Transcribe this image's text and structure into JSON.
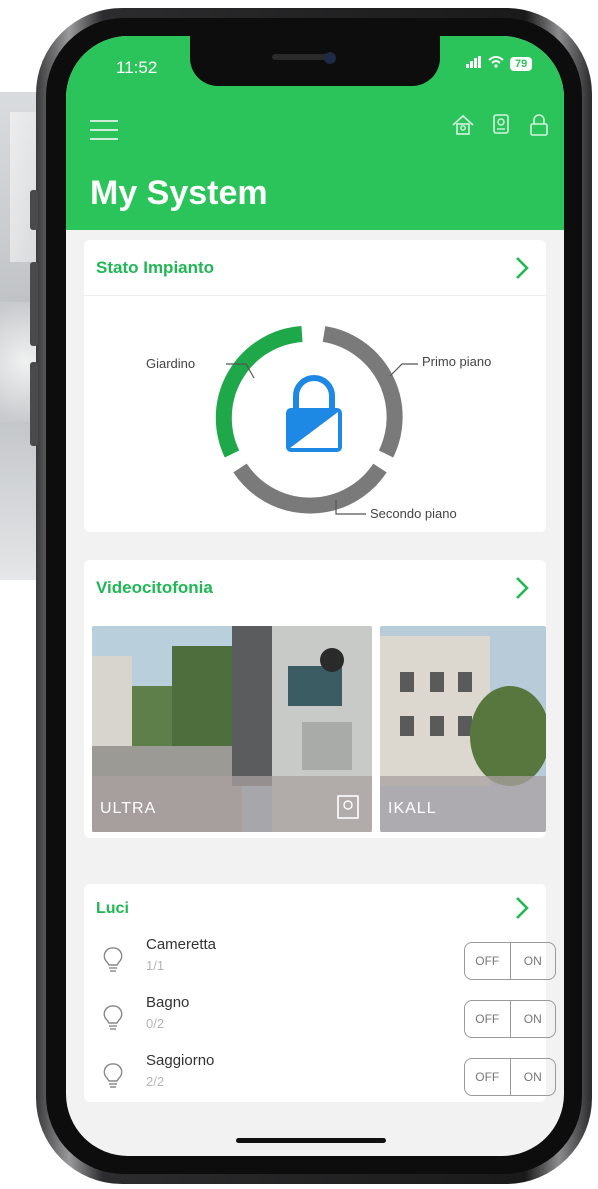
{
  "status_bar": {
    "time": "11:52",
    "signal": "•••",
    "battery": "79"
  },
  "header": {
    "title": "My System",
    "icons": [
      "menu-icon",
      "house-alarm-icon",
      "intercom-icon",
      "lock-icon"
    ]
  },
  "stato_impianto": {
    "title": "Stato Impianto",
    "zones": [
      "Giardino",
      "Primo piano",
      "Secondo piano"
    ],
    "colors": {
      "active": "#1fa84a",
      "inactive": "#7a7a7a",
      "lock": "#1e88e5"
    }
  },
  "videocitofonia": {
    "title": "Videocitofonia",
    "devices": [
      {
        "label": "ULTRA"
      },
      {
        "label": "IKALL"
      }
    ]
  },
  "luci": {
    "title": "Luci",
    "rooms": [
      {
        "name": "Cameretta",
        "count": "1/1",
        "off": "OFF",
        "on": "ON"
      },
      {
        "name": "Bagno",
        "count": "0/2",
        "off": "OFF",
        "on": "ON"
      },
      {
        "name": "Saggiorno",
        "count": "2/2",
        "off": "OFF",
        "on": "ON"
      }
    ]
  },
  "colors": {
    "brand_green": "#2bc45a",
    "title_green": "#1fb855"
  }
}
